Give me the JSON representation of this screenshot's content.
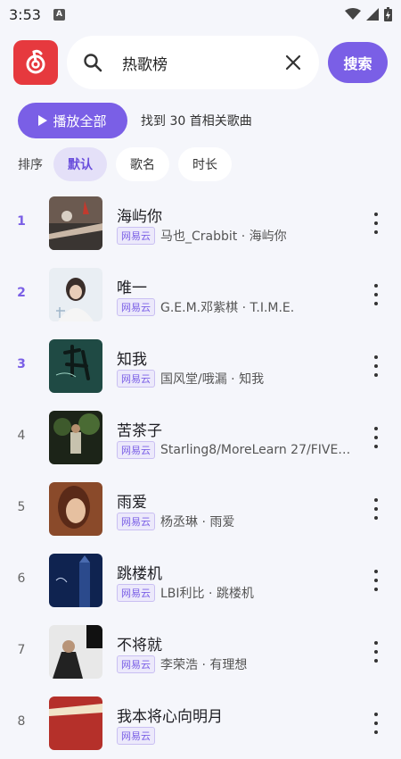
{
  "status": {
    "time": "3:53",
    "notif_letter": "A"
  },
  "search": {
    "query": "热歌榜",
    "button_label": "搜索"
  },
  "playbar": {
    "play_all_label": "播放全部",
    "found_text": "找到 30 首相关歌曲"
  },
  "sort": {
    "label": "排序",
    "options": [
      {
        "label": "默认",
        "active": true
      },
      {
        "label": "歌名",
        "active": false
      },
      {
        "label": "时长",
        "active": false
      }
    ]
  },
  "colors": {
    "accent": "#7a5fe6",
    "logo": "#e6393e"
  },
  "songs": [
    {
      "rank": "1",
      "title": "海屿你",
      "source": "网易云",
      "artist": "马也_Crabbit · 海屿你"
    },
    {
      "rank": "2",
      "title": "唯一",
      "source": "网易云",
      "artist": "G.E.M.邓紫棋 · T.I.M.E."
    },
    {
      "rank": "3",
      "title": "知我",
      "source": "网易云",
      "artist": "国风堂/哦漏 · 知我"
    },
    {
      "rank": "4",
      "title": "苦茶子",
      "source": "网易云",
      "artist": "Starling8/MoreLearn 27/FIVES…"
    },
    {
      "rank": "5",
      "title": "雨爱",
      "source": "网易云",
      "artist": "杨丞琳 · 雨爱"
    },
    {
      "rank": "6",
      "title": "跳楼机",
      "source": "网易云",
      "artist": "LBI利比 · 跳楼机"
    },
    {
      "rank": "7",
      "title": "不将就",
      "source": "网易云",
      "artist": "李荣浩 · 有理想"
    },
    {
      "rank": "8",
      "title": "我本将心向明月",
      "source": "网易云",
      "artist": ""
    }
  ]
}
